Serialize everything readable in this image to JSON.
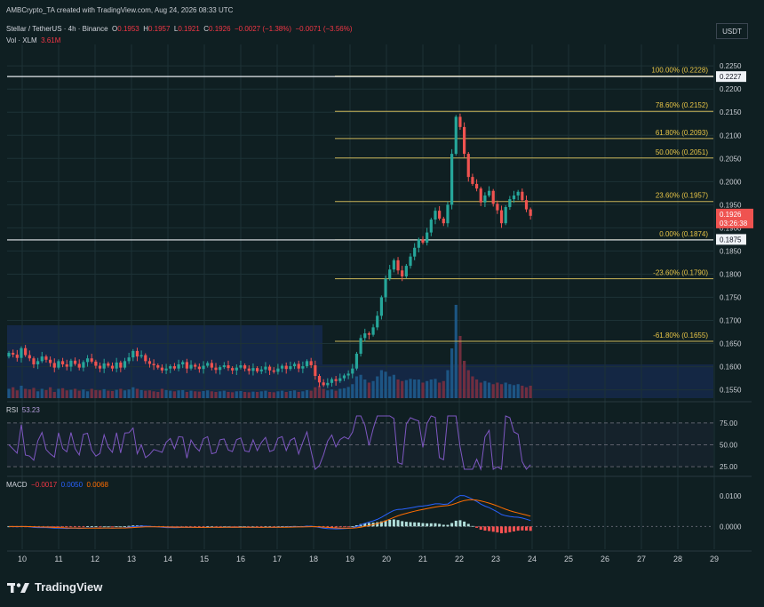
{
  "header": {
    "credit": "AMBCrypto_TA created with TradingView.com, Aug 24, 2026 08:33 UTC",
    "symbol": "Stellar / TetherUS · 4h · Binance",
    "o_label": "O",
    "o_val": "0.1953",
    "h_label": "H",
    "h_val": "0.1957",
    "l_label": "L",
    "l_val": "0.1921",
    "c_label": "C",
    "c_val": "0.1926",
    "change": "−0.0027 (−1.38%)",
    "change2": "−0.0071 (−3.56%)",
    "vol_label": "Vol · XLM",
    "vol_val": "3.61M",
    "currency": "USDT"
  },
  "rsi": {
    "label": "RSI",
    "value": "53.23",
    "levels": [
      "75.00",
      "50.00",
      "25.00"
    ]
  },
  "macd": {
    "label": "MACD",
    "hist": "−0.0017",
    "macd": "0.0050",
    "signal": "0.0068",
    "levels": [
      "0.0100",
      "0.0000"
    ]
  },
  "colors": {
    "bg": "#0f1f22",
    "up": "#26a69a",
    "down": "#ef5350",
    "fib": "#c9b458",
    "rsi": "#7e57c2",
    "macd": "#2962ff",
    "signal": "#ff6d00"
  },
  "branding": {
    "name": "TradingView"
  },
  "chart_data": {
    "type": "candlestick",
    "title": "Stellar / TetherUS · 4h · Binance",
    "price_ticks": [
      "0.2250",
      "0.2200",
      "0.2150",
      "0.2100",
      "0.2050",
      "0.2000",
      "0.1950",
      "0.1900",
      "0.1850",
      "0.1800",
      "0.1750",
      "0.1700",
      "0.1650",
      "0.1600",
      "0.1550"
    ],
    "x_ticks": [
      "10",
      "11",
      "12",
      "13",
      "14",
      "15",
      "16",
      "17",
      "18",
      "19",
      "20",
      "21",
      "22",
      "23",
      "24",
      "25",
      "26",
      "27",
      "28",
      "29"
    ],
    "price_range": [
      0.1532,
      0.2258
    ],
    "current_price": {
      "price": "0.1926",
      "countdown": "03:26:38"
    },
    "marked_levels": [
      "0.2227",
      "0.1875"
    ],
    "fib_levels": [
      {
        "label": "100.00% (0.2228)",
        "price": 0.2228
      },
      {
        "label": "78.60% (0.2152)",
        "price": 0.2152
      },
      {
        "label": "61.80% (0.2093)",
        "price": 0.2093
      },
      {
        "label": "50.00% (0.2051)",
        "price": 0.2051
      },
      {
        "label": "23.60% (0.1957)",
        "price": 0.1957
      },
      {
        "label": "0.00% (0.1874)",
        "price": 0.1874
      },
      {
        "label": "-23.60% (0.1790)",
        "price": 0.179
      },
      {
        "label": "-61.80% (0.1655)",
        "price": 0.1655
      }
    ],
    "anchor_level_price": 0.2227,
    "closes": [
      0.163,
      0.1626,
      0.1619,
      0.164,
      0.1625,
      0.1618,
      0.1605,
      0.1612,
      0.1622,
      0.1615,
      0.1608,
      0.1598,
      0.1612,
      0.1605,
      0.16,
      0.1613,
      0.1606,
      0.1598,
      0.161,
      0.1618,
      0.1611,
      0.1602,
      0.1596,
      0.1607,
      0.1602,
      0.1596,
      0.1609,
      0.1598,
      0.1612,
      0.162,
      0.1634,
      0.1622,
      0.1625,
      0.1612,
      0.1606,
      0.1603,
      0.1598,
      0.1592,
      0.1596,
      0.1601,
      0.1596,
      0.1605,
      0.161,
      0.1596,
      0.1604,
      0.16,
      0.1595,
      0.1602,
      0.1608,
      0.1598,
      0.1593,
      0.1599,
      0.1603,
      0.1597,
      0.1592,
      0.1598,
      0.1603,
      0.1596,
      0.1591,
      0.1597,
      0.159,
      0.1594,
      0.16,
      0.1592,
      0.1589,
      0.1596,
      0.1602,
      0.1595,
      0.1601,
      0.1606,
      0.1596,
      0.1601,
      0.1612,
      0.1603,
      0.158,
      0.1566,
      0.156,
      0.1565,
      0.1573,
      0.1569,
      0.1575,
      0.1581,
      0.1585,
      0.1596,
      0.1628,
      0.1662,
      0.1672,
      0.1669,
      0.1685,
      0.171,
      0.175,
      0.179,
      0.181,
      0.183,
      0.1808,
      0.1795,
      0.1818,
      0.1838,
      0.1857,
      0.1875,
      0.1868,
      0.189,
      0.1918,
      0.1937,
      0.192,
      0.191,
      0.195,
      0.206,
      0.214,
      0.2118,
      0.206,
      0.201,
      0.1995,
      0.1985,
      0.1955,
      0.197,
      0.198,
      0.1952,
      0.1938,
      0.191,
      0.1945,
      0.1962,
      0.197,
      0.1978,
      0.196,
      0.194,
      0.1926
    ],
    "volumes": [
      0.3,
      0.35,
      0.25,
      0.4,
      0.3,
      0.28,
      0.33,
      0.22,
      0.3,
      0.26,
      0.35,
      0.2,
      0.3,
      0.32,
      0.25,
      0.27,
      0.3,
      0.24,
      0.28,
      0.22,
      0.3,
      0.26,
      0.25,
      0.29,
      0.24,
      0.23,
      0.27,
      0.3,
      0.25,
      0.28,
      0.35,
      0.3,
      0.26,
      0.24,
      0.25,
      0.22,
      0.2,
      0.3,
      0.26,
      0.24,
      0.22,
      0.25,
      0.26,
      0.2,
      0.24,
      0.22,
      0.21,
      0.23,
      0.25,
      0.22,
      0.2,
      0.22,
      0.24,
      0.2,
      0.19,
      0.22,
      0.23,
      0.2,
      0.19,
      0.21,
      0.2,
      0.22,
      0.24,
      0.2,
      0.19,
      0.22,
      0.24,
      0.2,
      0.23,
      0.25,
      0.2,
      0.22,
      0.26,
      0.24,
      0.35,
      0.4,
      0.3,
      0.25,
      0.28,
      0.24,
      0.3,
      0.32,
      0.36,
      0.45,
      0.7,
      0.75,
      0.6,
      0.5,
      0.55,
      0.7,
      0.9,
      0.85,
      0.7,
      0.75,
      0.6,
      0.55,
      0.58,
      0.62,
      0.6,
      0.6,
      0.5,
      0.55,
      0.6,
      0.62,
      0.5,
      0.55,
      0.9,
      1.6,
      3.0,
      2.0,
      1.2,
      0.9,
      0.7,
      0.6,
      0.5,
      0.55,
      0.5,
      0.45,
      0.5,
      0.45,
      0.5,
      0.45,
      0.42,
      0.45,
      0.4,
      0.35,
      0.4
    ],
    "rsi_range": [
      20,
      85
    ],
    "macd_range": [
      -0.004,
      0.013
    ]
  }
}
